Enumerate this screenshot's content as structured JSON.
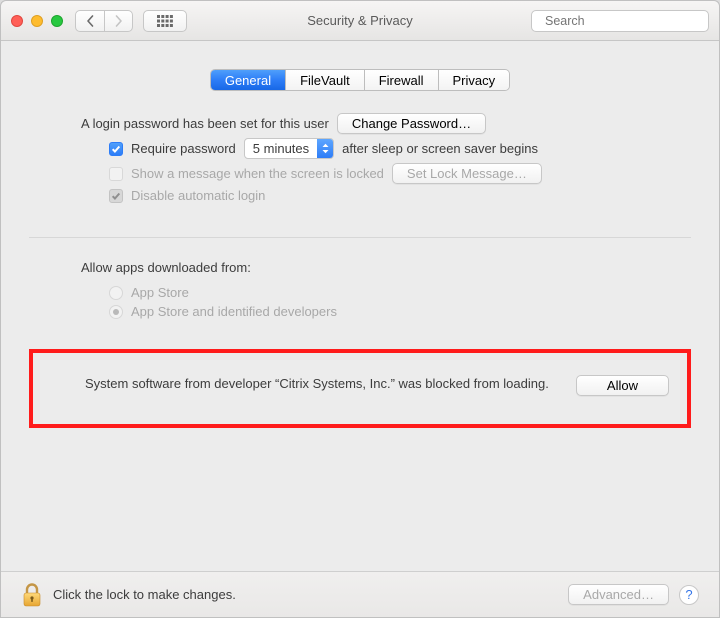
{
  "window": {
    "title": "Security & Privacy"
  },
  "search": {
    "placeholder": "Search"
  },
  "tabs": [
    {
      "label": "General",
      "active": true
    },
    {
      "label": "FileVault",
      "active": false
    },
    {
      "label": "Firewall",
      "active": false
    },
    {
      "label": "Privacy",
      "active": false
    }
  ],
  "general": {
    "login_password_set_label": "A login password has been set for this user",
    "change_password_label": "Change Password…",
    "require_password_label": "Require password",
    "require_password_delay": "5 minutes",
    "require_password_suffix": "after sleep or screen saver begins",
    "show_message_label": "Show a message when the screen is locked",
    "set_lock_message_label": "Set Lock Message…",
    "disable_auto_login_label": "Disable automatic login",
    "allow_apps_heading": "Allow apps downloaded from:",
    "allow_apps_options": [
      {
        "label": "App Store",
        "selected": false
      },
      {
        "label": "App Store and identified developers",
        "selected": true
      }
    ],
    "blocked": {
      "message": "System software from developer “Citrix Systems, Inc.” was blocked from loading.",
      "allow_label": "Allow"
    }
  },
  "footer": {
    "lock_hint": "Click the lock to make changes.",
    "advanced_label": "Advanced…"
  }
}
